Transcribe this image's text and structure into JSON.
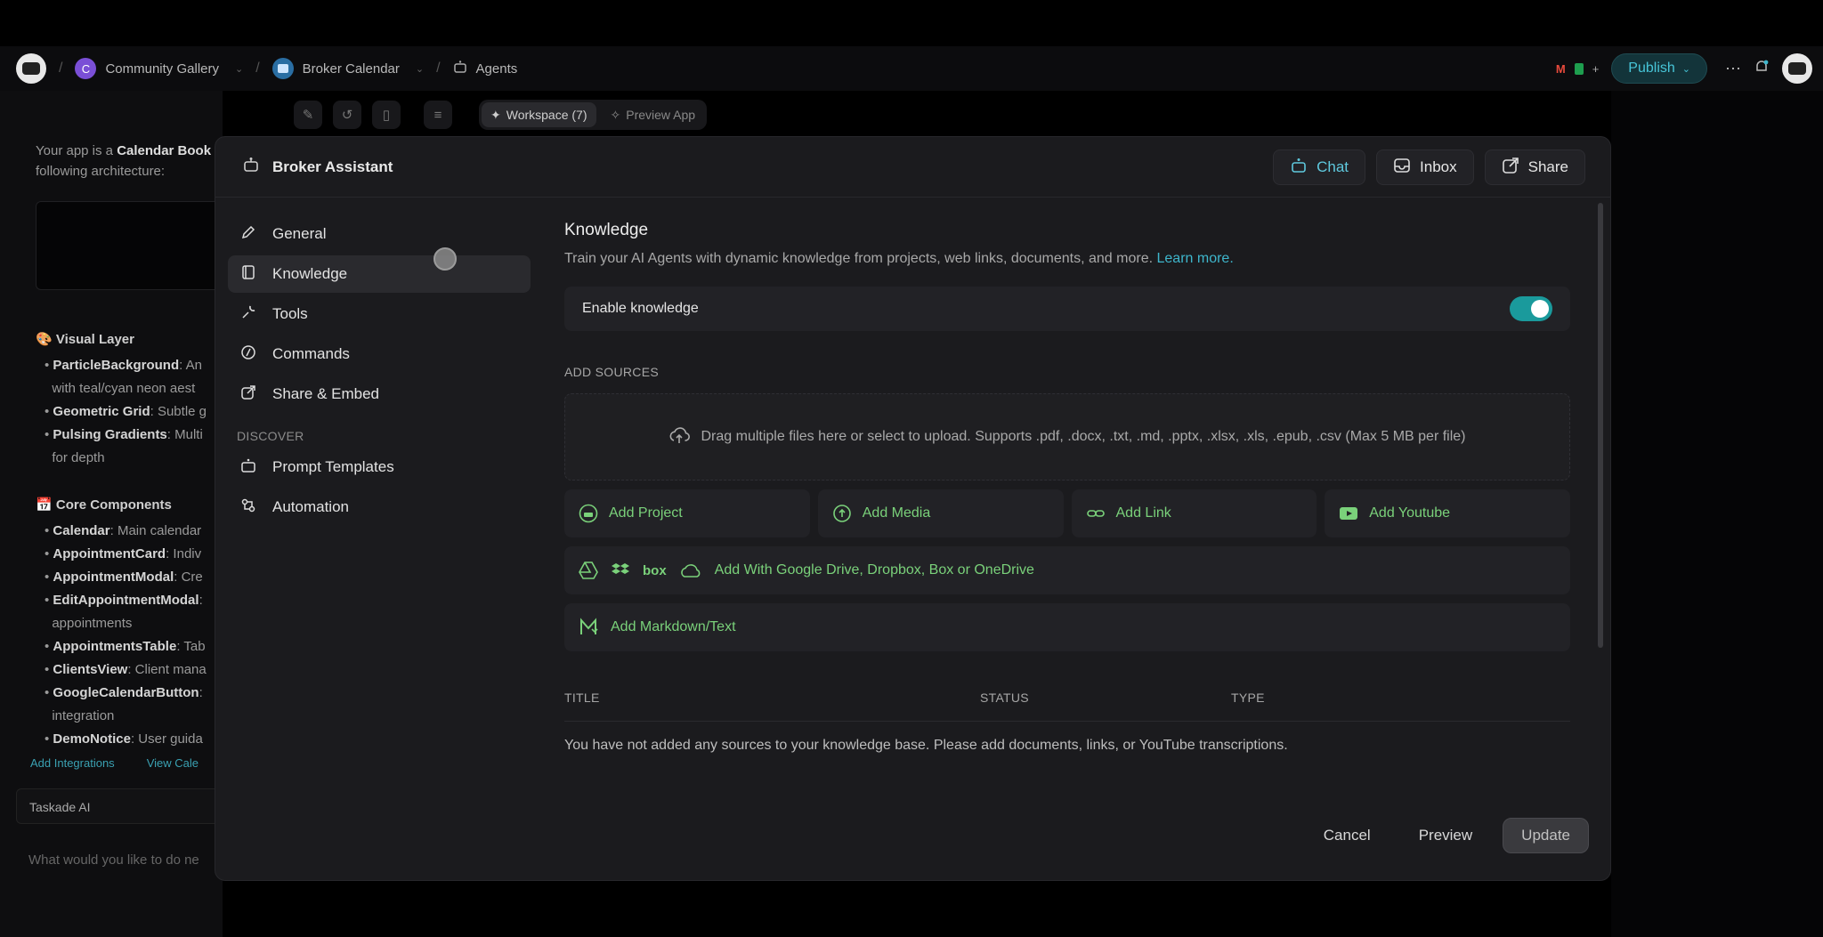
{
  "breadcrumbs": [
    {
      "label": "Community Gallery",
      "badge": "C",
      "badge_color": "#7a4fd6"
    },
    {
      "label": "Broker Calendar",
      "badge": "",
      "badge_color": "#2a6ea3"
    },
    {
      "label": "Agents"
    }
  ],
  "appbar": {
    "publish_label": "Publish"
  },
  "toolbar": {
    "workspace_label": "Workspace (7)",
    "preview_label": "Preview App"
  },
  "left_panel": {
    "intro_pre": "Your app is a ",
    "intro_bold": "Calendar Book",
    "intro_post": "following architecture:",
    "visual_heading": "Visual Layer",
    "visual_items": [
      {
        "bold": "ParticleBackground",
        "text": ": An"
      },
      {
        "bold": "",
        "text": "with teal/cyan neon aest"
      },
      {
        "bold": "Geometric Grid",
        "text": ": Subtle g"
      },
      {
        "bold": "Pulsing Gradients",
        "text": ": Multi"
      },
      {
        "bold": "",
        "text": "for depth"
      }
    ],
    "core_heading": "Core Components",
    "core_items": [
      {
        "bold": "Calendar",
        "text": ": Main calendar"
      },
      {
        "bold": "AppointmentCard",
        "text": ": Indiv"
      },
      {
        "bold": "AppointmentModal",
        "text": ": Cre"
      },
      {
        "bold": "EditAppointmentModal",
        "text": ":"
      },
      {
        "bold": "",
        "text": "appointments"
      },
      {
        "bold": "AppointmentsTable",
        "text": ": Tab"
      },
      {
        "bold": "ClientsView",
        "text": ": Client mana"
      },
      {
        "bold": "GoogleCalendarButton",
        "text": ":"
      },
      {
        "bold": "",
        "text": "integration"
      },
      {
        "bold": "DemoNotice",
        "text": ": User guida"
      }
    ],
    "link_integrations": "Add Integrations",
    "link_view": "View Cale",
    "taskade_label": "Taskade AI",
    "prompt_placeholder": "What would you like to do ne"
  },
  "modal": {
    "title": "Broker Assistant",
    "header_buttons": {
      "chat": "Chat",
      "inbox": "Inbox",
      "share": "Share"
    },
    "nav": {
      "general": "General",
      "knowledge": "Knowledge",
      "tools": "Tools",
      "commands": "Commands",
      "share_embed": "Share & Embed",
      "discover_label": "DISCOVER",
      "prompt_templates": "Prompt Templates",
      "automation": "Automation"
    },
    "knowledge": {
      "title": "Knowledge",
      "subtitle": "Train your AI Agents with dynamic knowledge from projects, web links, documents, and more.",
      "learn_more": "Learn more.",
      "enable_label": "Enable knowledge",
      "enabled": true,
      "add_sources_label": "ADD SOURCES",
      "dropzone_text": "Drag multiple files here or select to upload. Supports .pdf, .docx, .txt, .md, .pptx, .xlsx, .xls, .epub, .csv (Max 5 MB per file)",
      "add_project": "Add Project",
      "add_media": "Add Media",
      "add_link": "Add Link",
      "add_youtube": "Add Youtube",
      "cloud_box_text": "box",
      "add_cloud": "Add With Google Drive, Dropbox, Box or OneDrive",
      "add_markdown": "Add Markdown/Text",
      "table_headers": {
        "title": "TITLE",
        "status": "STATUS",
        "type": "TYPE"
      },
      "empty_message": "You have not added any sources to your knowledge base. Please add documents, links, or YouTube transcriptions."
    },
    "footer": {
      "cancel": "Cancel",
      "preview": "Preview",
      "update": "Update"
    }
  },
  "colors": {
    "accent_teal": "#1a9a9c",
    "link_teal": "#3eb6cc",
    "source_green": "#7ad17a"
  }
}
